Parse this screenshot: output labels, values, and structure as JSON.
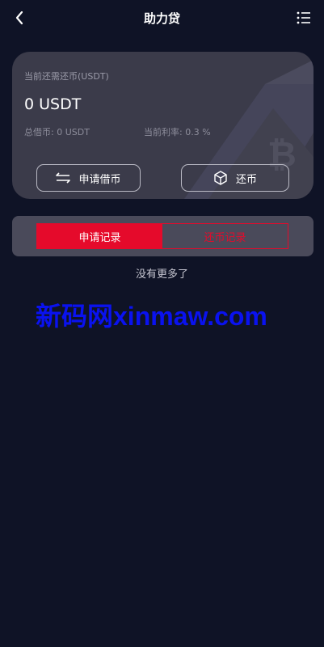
{
  "header": {
    "title": "助力贷",
    "back_icon": "chevron-left-icon",
    "menu_icon": "list-icon"
  },
  "card": {
    "label": "当前还需还币(USDT)",
    "amount": "0 USDT",
    "total_borrowed": "总借币: 0 USDT",
    "current_rate": "当前利率: 0.3 %",
    "borrow_button": "申请借币",
    "repay_button": "还币",
    "decoration_icon": "bitcoin-icon"
  },
  "tabs": {
    "apply_records": "申请记录",
    "repay_records": "还币记录",
    "active": "apply_records"
  },
  "list": {
    "no_more": "没有更多了"
  },
  "watermark": {
    "text": "新码网xinmaw.com"
  },
  "colors": {
    "background": "#0f1326",
    "card": "#3b3b4a",
    "tab_panel": "#4a4a5a",
    "accent": "#e50a2b",
    "watermark": "#0a12f0"
  }
}
